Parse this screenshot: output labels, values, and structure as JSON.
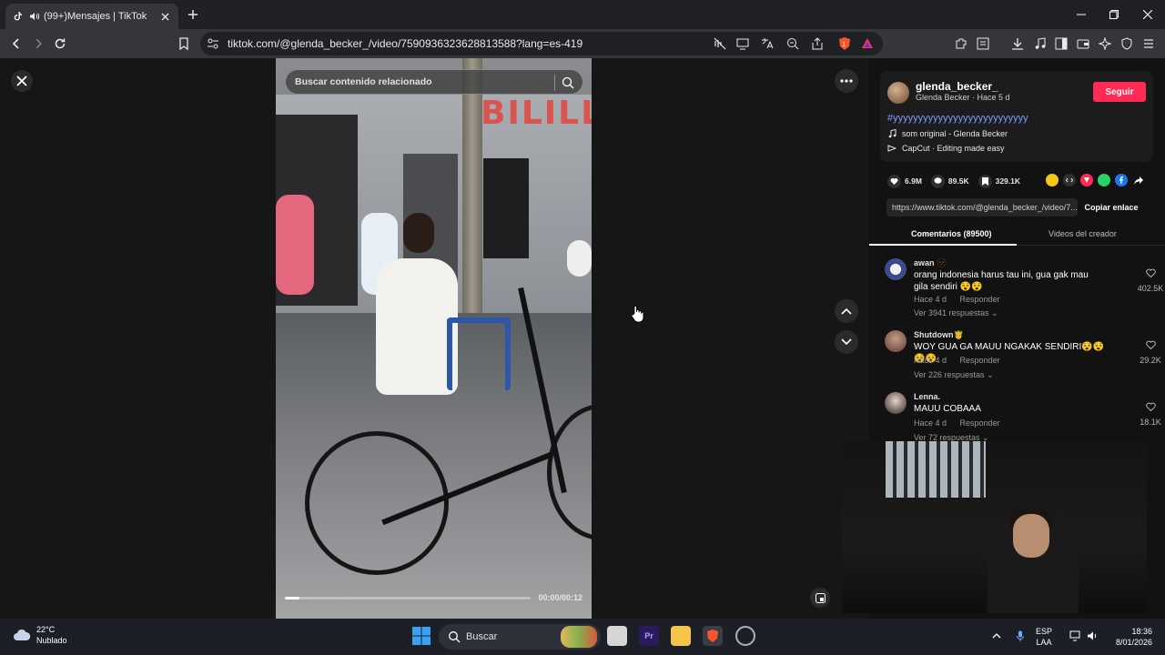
{
  "browser": {
    "tab_title": "(99+)Mensajes | TikTok",
    "url": "tiktok.com/@glenda_becker_/video/7590936323628813588?lang=es-419"
  },
  "video": {
    "search_placeholder": "Buscar contenido relacionado",
    "sign_text": "BILILLE",
    "timecode": "00:00/00:12",
    "progress": 0.06
  },
  "author": {
    "username": "glenda_becker_",
    "subline": "Glenda Becker · Hace 5 d",
    "follow_label": "Seguir",
    "hashtag": "#yyyyyyyyyyyyyyyyyyyyyyyyyyy",
    "music": "som original - Glenda Becker",
    "capcut": "CapCut · Editing made easy"
  },
  "stats": {
    "likes": "6.9M",
    "comments": "89.5K",
    "saves": "329.1K"
  },
  "share": {
    "link": "https://www.tiktok.com/@glenda_becker_/video/7...",
    "copy_label": "Copiar enlace"
  },
  "tabs": {
    "comments": "Comentarios (89500)",
    "creator_videos": "Videos del creador"
  },
  "comments": [
    {
      "name": "awan 🫥",
      "text": "orang indonesia harus tau ini, gua gak mau gila sendiri 😵😵",
      "time": "Hace 4 d",
      "reply": "Responder",
      "replies": "Ver 3941 respuestas ⌄",
      "likes": "402.5K"
    },
    {
      "name": "Shutdown🤴",
      "text": "WOY GUA GA MAUU NGAKAK SENDIRI😵😵😵😵",
      "time": "Hace 4 d",
      "reply": "Responder",
      "replies": "Ver 226 respuestas ⌄",
      "likes": "29.2K"
    },
    {
      "name": "Lenna.",
      "text": "MAUU COBAAA",
      "time": "Hace 4 d",
      "reply": "Responder",
      "replies": "Ver 72 respuestas ⌄",
      "likes": "18.1K"
    }
  ],
  "taskbar": {
    "temp": "22°C",
    "weather": "Nublado",
    "search_label": "Buscar",
    "lang1": "ESP",
    "lang2": "LAA",
    "time": "18:36",
    "date": "8/01/2026"
  },
  "colors": {
    "accent": "#fe2c55",
    "hashtag": "#7c9cff"
  }
}
